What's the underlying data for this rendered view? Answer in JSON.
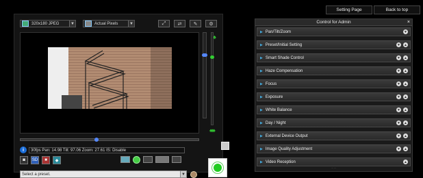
{
  "top_nav": {
    "setting_page": "Setting Page",
    "back_to_top": "Back to top"
  },
  "viewer": {
    "resolution": "320x180 JPEG",
    "pixel_mode": "Actual Pixels",
    "toolbar_icons": [
      "fit-icon",
      "swap-icon",
      "brush-icon",
      "settings-wheel-icon"
    ],
    "status_text": "30fps Pan: 14.98 Tilt: 97.06 Zoom: 27.61 IS: Disable",
    "preset_placeholder": "Select a preset.",
    "tilt_level": 0.75,
    "zoom_level": 0.75,
    "pan_level": 0.42
  },
  "admin": {
    "title": "Control for Admin",
    "close": "×",
    "items": [
      {
        "label": "Pan/Tilt/Zoom",
        "buttons": [
          "▼"
        ]
      },
      {
        "label": "Preset/Initial Setting",
        "buttons": [
          "▼",
          "▲"
        ]
      },
      {
        "label": "Smart Shade Control",
        "buttons": [
          "▼",
          "▲"
        ]
      },
      {
        "label": "Haze Compensation",
        "buttons": [
          "▼",
          "▲"
        ]
      },
      {
        "label": "Focus",
        "buttons": [
          "▼",
          "▲"
        ]
      },
      {
        "label": "Exposure",
        "buttons": [
          "▼",
          "▲"
        ]
      },
      {
        "label": "White Balance",
        "buttons": [
          "▼",
          "▲"
        ]
      },
      {
        "label": "Day / Night",
        "buttons": [
          "▼",
          "▲"
        ]
      },
      {
        "label": "External Device Output",
        "buttons": [
          "▼",
          "▲"
        ]
      },
      {
        "label": "Image Quality Adjustment",
        "buttons": [
          "▼",
          "▲"
        ]
      },
      {
        "label": "Video Reception",
        "buttons": [
          "▲"
        ]
      }
    ]
  }
}
